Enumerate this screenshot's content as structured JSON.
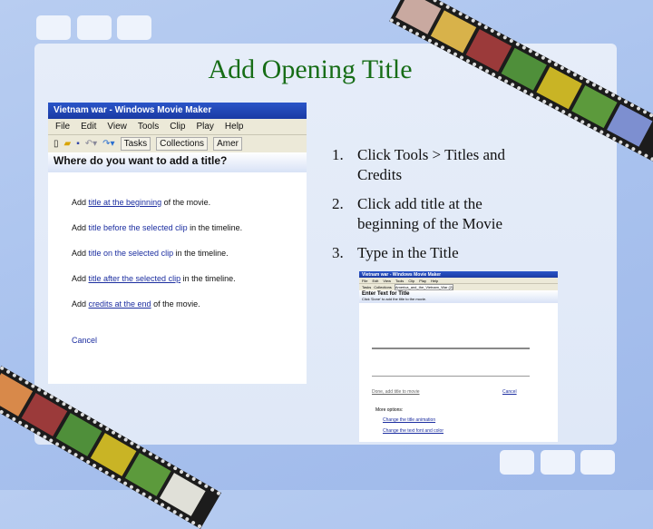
{
  "slide": {
    "title": "Add Opening Title"
  },
  "screenshot1": {
    "window_title": "Vietnam war - Windows Movie Maker",
    "menu": [
      "File",
      "Edit",
      "View",
      "Tools",
      "Clip",
      "Play",
      "Help"
    ],
    "toolbar": {
      "tasks": "Tasks",
      "collections": "Collections",
      "combo": "Amer"
    },
    "heading": "Where do you want to add a title?",
    "options": [
      {
        "pre": "Add ",
        "link": "title at the beginning",
        "post": " of the movie."
      },
      {
        "pre": "Add ",
        "link": "title before the selected clip",
        "post": " in the timeline."
      },
      {
        "pre": "Add ",
        "link": "title on the selected clip",
        "post": " in the timeline."
      },
      {
        "pre": "Add ",
        "link": "title after the selected clip",
        "post": " in the timeline."
      },
      {
        "pre": "Add ",
        "link": "credits at the end",
        "post": " of the movie."
      }
    ],
    "cancel": "Cancel"
  },
  "steps": [
    {
      "num": "1.",
      "text": "Click Tools > Titles and Credits"
    },
    {
      "num": "2.",
      "text": " Click add title at the beginning of the Movie"
    },
    {
      "num": "3.",
      "text": "Type in the Title"
    }
  ],
  "screenshot2": {
    "window_title": "Vietnam war - Windows Movie Maker",
    "menu": [
      "File",
      "Edit",
      "View",
      "Tools",
      "Clip",
      "Play",
      "Help"
    ],
    "toolbar": {
      "tasks": "Tasks",
      "collections": "Collections",
      "combo": "America_and_the_Vietnam_War (2)"
    },
    "heading": "Enter Text for Title",
    "subheading": "Click 'Done' to add the title to the movie.",
    "done": "Done, add title to movie",
    "cancel": "Cancel",
    "more_options": "More options:",
    "links": [
      "Change the title animation",
      "Change the text font and color"
    ]
  },
  "colors": {
    "title": "#176d17",
    "link": "#1c2ea0",
    "background": "#a9c2ee"
  }
}
